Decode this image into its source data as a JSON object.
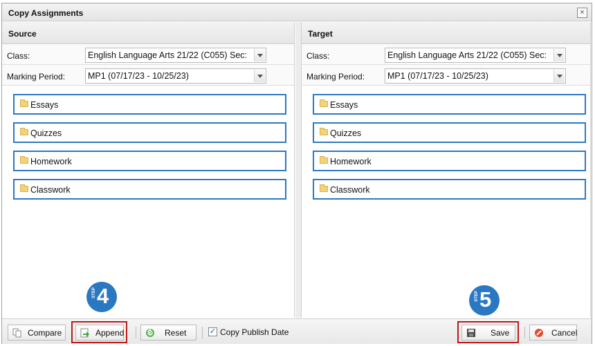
{
  "dialog": {
    "title": "Copy Assignments",
    "close_symbol": "×"
  },
  "source": {
    "title": "Source",
    "class_label": "Class:",
    "class_value": "English Language Arts 21/22 (C055) Sec:",
    "mp_label": "Marking Period:",
    "mp_value": "MP1 (07/17/23 - 10/25/23)",
    "folders": [
      "Essays",
      "Quizzes",
      "Homework",
      "Classwork"
    ]
  },
  "target": {
    "title": "Target",
    "class_label": "Class:",
    "class_value": "English Language Arts 21/22 (C055) Sec:",
    "mp_label": "Marking Period:",
    "mp_value": "MP1 (07/17/23 - 10/25/23)",
    "folders": [
      "Essays",
      "Quizzes",
      "Homework",
      "Classwork"
    ]
  },
  "footer": {
    "compare": "Compare",
    "append": "Append",
    "reset": "Reset",
    "copy_publish_date": "Copy Publish Date",
    "copy_publish_checked": true,
    "save": "Save",
    "cancel": "Cancel"
  },
  "steps": {
    "step_word": "STEP",
    "step4": "4",
    "step5": "5"
  },
  "colors": {
    "accent": "#2a78c2",
    "highlight": "#c01818"
  }
}
